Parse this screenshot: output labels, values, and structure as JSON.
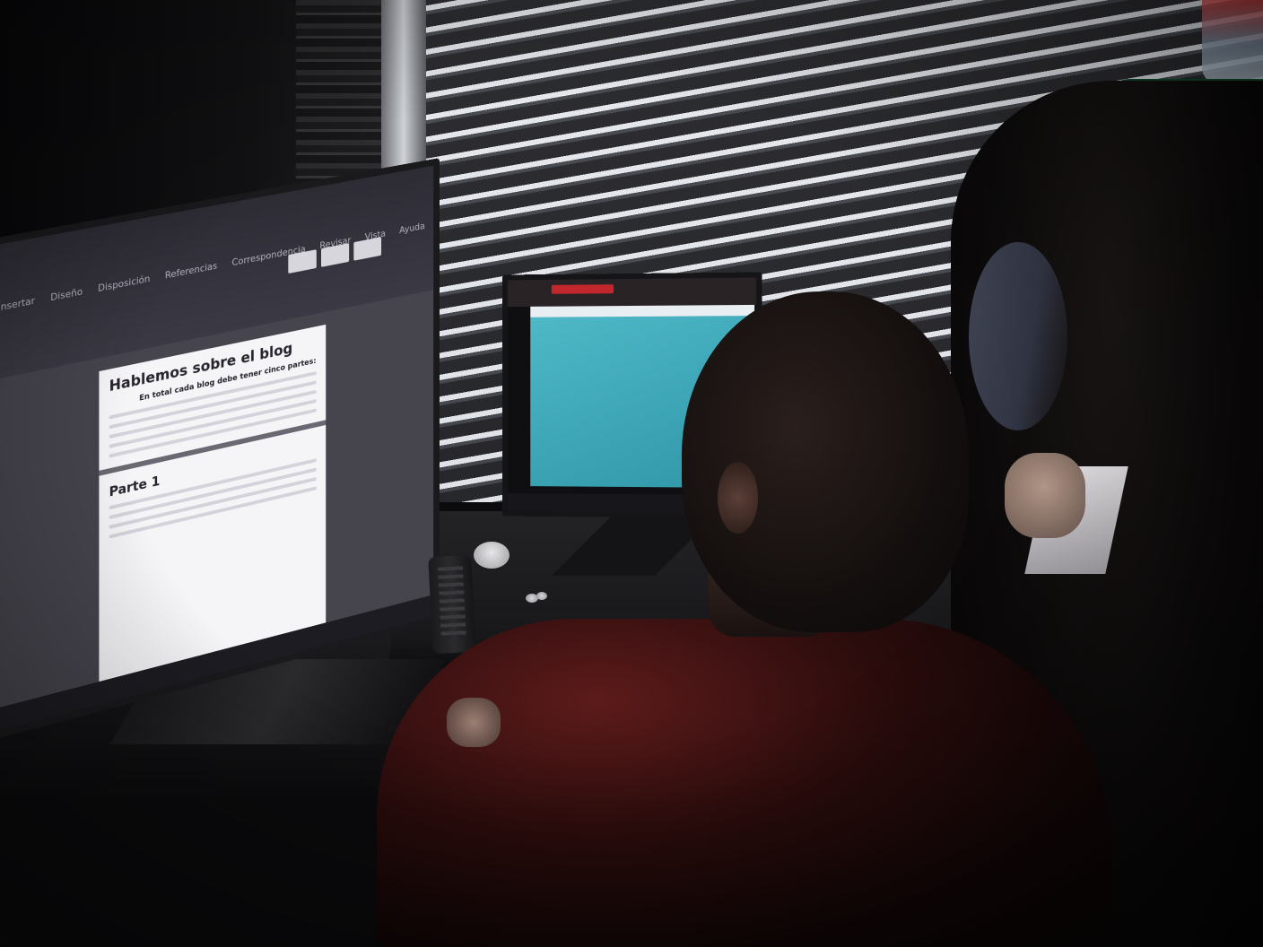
{
  "left_monitor": {
    "ribbon_tabs": [
      "Insertar",
      "Diseño",
      "Disposición",
      "Referencias",
      "Correspondencia",
      "Revisar",
      "Vista",
      "Ayuda"
    ],
    "document_title": "Hablemos sobre el blog",
    "document_subtitle": "En total cada blog debe tener cinco partes:",
    "section_heading": "Parte 1"
  }
}
